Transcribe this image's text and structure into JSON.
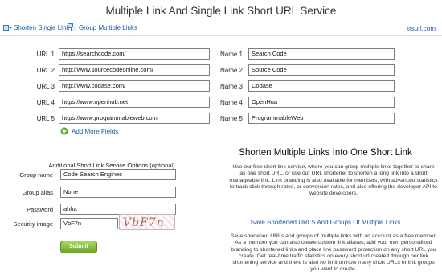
{
  "title": "Multiple Link And Single Link Short URL Service",
  "nav": {
    "shorten_single": "Shorten Single Link",
    "group_multiple": "Group Multiple Links",
    "site": "trsurl.com"
  },
  "urls": [
    {
      "label": "URL 1",
      "value": "https://searchcode.com/"
    },
    {
      "label": "URL 2",
      "value": "http://www.sourcecodeonline.com/"
    },
    {
      "label": "URL 3",
      "value": "http://www.codase.com/"
    },
    {
      "label": "URL 4",
      "value": "https://www.openhub.net"
    },
    {
      "label": "URL 5",
      "value": "https://www.programmableweb.com"
    }
  ],
  "names": [
    {
      "label": "Name 1",
      "value": "Search Code"
    },
    {
      "label": "Name 2",
      "value": "Source Code"
    },
    {
      "label": "Name 3",
      "value": "Codase"
    },
    {
      "label": "Name 4",
      "value": "OpenHua"
    },
    {
      "label": "Name 5",
      "value": "ProgrammableWeb"
    }
  ],
  "add_more": "Add More Fields",
  "options_heading": "Additional Short Link Service Options (optional)",
  "group": {
    "name_label": "Group name",
    "name_value": "Code Search Engines",
    "alias_label": "Group alias",
    "alias_value": "None",
    "password_label": "Password",
    "password_value": "ahha",
    "security_label": "Security image",
    "security_value": "VbF7n",
    "captcha_text": "VbF7n"
  },
  "submit_label": "Submit",
  "right": {
    "heading": "Shorten Multiple Links Into One Short Link",
    "paragraph1": "Use our free short link service, where you can group multiple links together to share as one short URL, or use our URL shortener to shorten a long link into a short manageable link. Link branding is also available for members, with advanced statistics to track click through rates, or conversion rates, and also offering the developer API to website developers.",
    "subheading": "Save Shortened URLS And Groups Of Multiple Links",
    "paragraph2": "Save shortened URLs and groups of multiple links with an account as a free member. As a member you can also create custom link aliases, add your own personalized branding to shortened links and place link password protection on any short URL you create. Get real-time traffic statistics on every short url created through our link shortening service and there is also no limit on how many short URLs or link groups you want to create."
  },
  "colors": {
    "link": "#1a5aa8",
    "submit": "#7ab52e"
  }
}
